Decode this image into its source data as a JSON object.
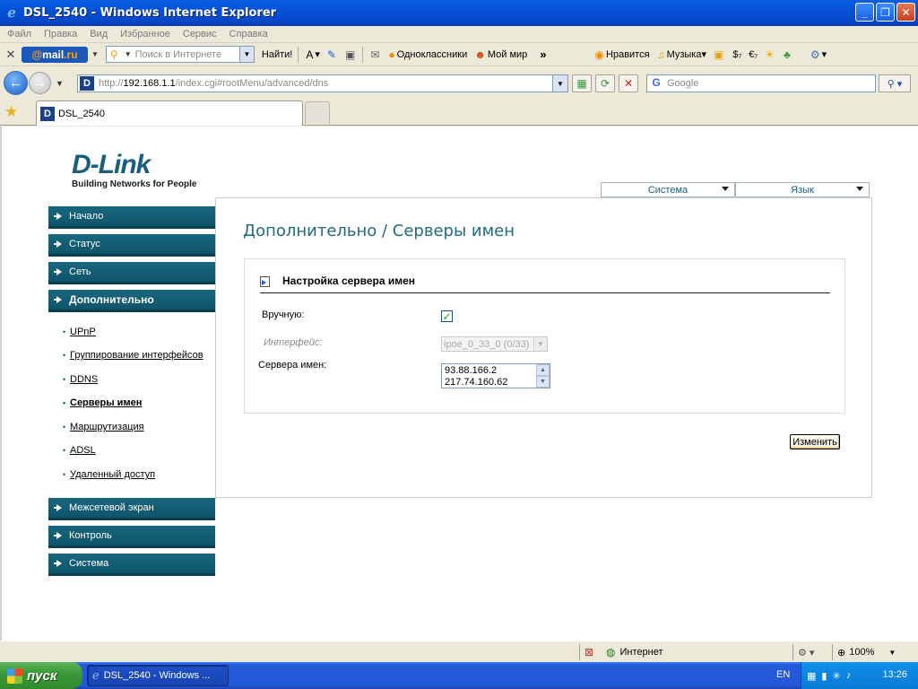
{
  "window": {
    "title": "DSL_2540 - Windows Internet Explorer",
    "buttons": {
      "minimize": "_",
      "maximize": "❐",
      "close": "✕"
    }
  },
  "menubar": [
    "Файл",
    "Правка",
    "Вид",
    "Избранное",
    "Сервис",
    "Справка"
  ],
  "toolbar": {
    "brand_prefix": "@",
    "brand_main": "mail",
    "brand_suffix": ".ru",
    "search_placeholder": "Поиск в Интернете",
    "find_button": "Найти!",
    "links": [
      "Одноклассники",
      "Мой мир"
    ],
    "more": "»",
    "right_links": [
      "Нравится",
      "Музыка"
    ],
    "currency": [
      "$₇",
      "€₇"
    ]
  },
  "address": {
    "protocol": "http://",
    "host": "192.168.1.1",
    "path": "/index.cgi#rootMenu/advanced/dns",
    "search_placeholder": "Google"
  },
  "tab": {
    "title": "DSL_2540"
  },
  "page": {
    "logo": {
      "brand": "D-Link",
      "tagline": "Building Networks for People"
    },
    "top_selects": {
      "system": "Система",
      "language": "Язык"
    },
    "menu": [
      {
        "label": "Начало"
      },
      {
        "label": "Статус"
      },
      {
        "label": "Сеть"
      },
      {
        "label": "Дополнительно"
      },
      {
        "label": "Межсетевой экран"
      },
      {
        "label": "Контроль"
      },
      {
        "label": "Система"
      }
    ],
    "submenu": [
      {
        "label": "UPnP"
      },
      {
        "label": "Группирование интерфейсов"
      },
      {
        "label": "DDNS"
      },
      {
        "label": "Серверы имен"
      },
      {
        "label": "Маршрутизация"
      },
      {
        "label": "ADSL"
      },
      {
        "label": "Удаленный доступ"
      }
    ],
    "heading": "Дополнительно /  Серверы имен",
    "section_title": "Настройка сервера имен",
    "manual_label": "Вручную:",
    "manual_checked": true,
    "interface_label": "Интерфейс:",
    "interface_value": "ipoe_0_33_0 (0/33)",
    "dns_label": "Сервера имен:",
    "dns_servers": [
      "93.88.166.2",
      "217.74.160.62"
    ],
    "apply_button": "Изменить"
  },
  "statusbar": {
    "zone": "Интернет",
    "zoom": "100%"
  },
  "taskbar": {
    "start": "пуск",
    "task": "DSL_2540 - Windows ...",
    "lang": "EN",
    "clock": "13:26"
  }
}
